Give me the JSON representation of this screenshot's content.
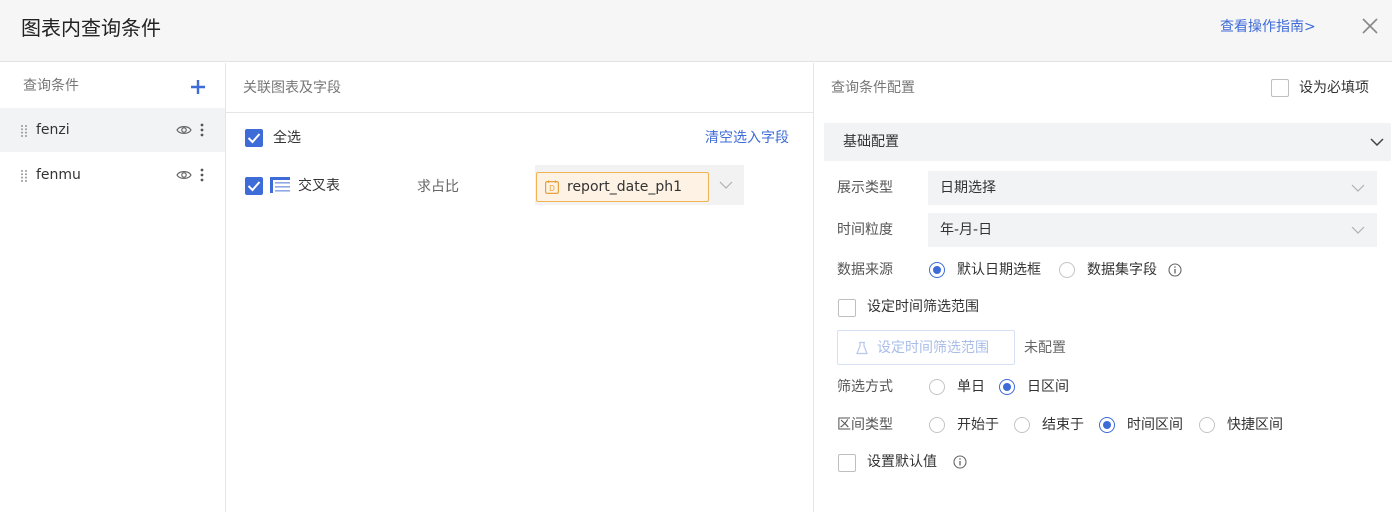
{
  "dialog": {
    "title": "图表内查询条件",
    "guide_link": "查看操作指南>"
  },
  "conditions": {
    "header": "查询条件",
    "items": [
      {
        "name": "fenzi",
        "active": true
      },
      {
        "name": "fenmu",
        "active": false
      }
    ]
  },
  "linked": {
    "header": "关联图表及字段",
    "select_all": "全选",
    "select_all_checked": true,
    "clear_link": "清空选入字段",
    "rows": [
      {
        "chart_name": "交叉表",
        "metric": "求占比",
        "field": "report_date_ph1",
        "checked": true
      }
    ]
  },
  "config": {
    "header": "查询条件配置",
    "required_label": "设为必填项",
    "required_checked": false,
    "section_title": "基础配置",
    "display_type": {
      "label": "展示类型",
      "value": "日期选择"
    },
    "granularity": {
      "label": "时间粒度",
      "value": "年-月-日"
    },
    "data_source": {
      "label": "数据来源",
      "options": [
        "默认日期选框",
        "数据集字段"
      ],
      "selected": "默认日期选框"
    },
    "time_range": {
      "label": "设定时间筛选范围",
      "checked": false,
      "button": "设定时间筛选范围",
      "status": "未配置"
    },
    "filter_mode": {
      "label": "筛选方式",
      "options": [
        "单日",
        "日区间"
      ],
      "selected": "日区间"
    },
    "range_type": {
      "label": "区间类型",
      "options": [
        "开始于",
        "结束于",
        "时间区间",
        "快捷区间"
      ],
      "selected": "时间区间"
    },
    "default_value": {
      "label": "设置默认值",
      "checked": false
    }
  },
  "colors": {
    "accent": "#3d6bd8",
    "tag_border": "#f0b452",
    "tag_bg": "#fdf2e4"
  }
}
